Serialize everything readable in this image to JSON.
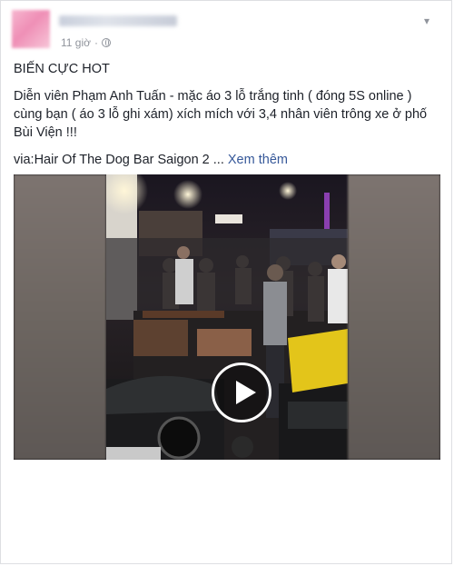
{
  "post": {
    "time": "11 giờ",
    "title": "BIẾN CỰC HOT",
    "body": "Diễn viên Phạm Anh Tuấn - mặc áo 3 lỗ trắng tinh ( đóng 5S online ) cùng bạn ( áo 3 lỗ ghi xám) xích mích với 3,4 nhân viên trông xe ở phố Bùi Viện !!!",
    "via": "via:Hair Of The Dog Bar Saigon 2 ...",
    "see_more": "Xem thêm"
  },
  "icons": {
    "privacy": "globe-icon",
    "options": "chevron-down-icon",
    "play": "play-icon"
  },
  "colors": {
    "link": "#365899",
    "meta": "#90949c",
    "text": "#1d2129"
  }
}
